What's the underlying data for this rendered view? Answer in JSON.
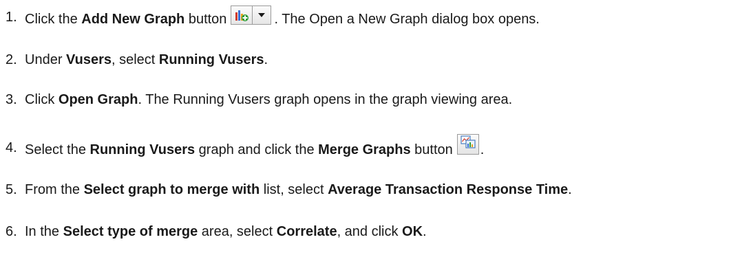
{
  "steps": [
    {
      "number": "1.",
      "parts": [
        "Click the ",
        "Add New Graph",
        " button",
        ". The Open a New Graph dialog box opens."
      ]
    },
    {
      "number": "2.",
      "parts": [
        "Under ",
        "Vusers",
        ", select ",
        "Running Vusers",
        "."
      ]
    },
    {
      "number": "3.",
      "parts": [
        "Click ",
        "Open Graph",
        ". The Running Vusers graph opens in the graph viewing area."
      ]
    },
    {
      "number": "4.",
      "parts": [
        "Select the ",
        "Running Vusers",
        " graph and click the ",
        "Merge Graphs",
        " button",
        "."
      ]
    },
    {
      "number": "5.",
      "parts": [
        "From the ",
        "Select graph to merge with",
        " list, select ",
        "Average Transaction Response Time",
        "."
      ]
    },
    {
      "number": "6.",
      "parts": [
        "In the ",
        "Select type of merge",
        " area, select ",
        "Correlate",
        ", and click ",
        "OK",
        "."
      ]
    }
  ],
  "icons": {
    "add_graph": "add-graph-icon",
    "dropdown": "chevron-down-icon",
    "merge_graphs": "merge-graphs-icon"
  }
}
